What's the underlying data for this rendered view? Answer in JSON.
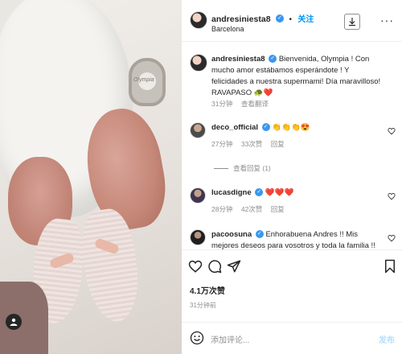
{
  "photo": {
    "pacifier_text": "Olympia"
  },
  "header": {
    "username": "andresiniesta8",
    "verified_mark": "✓",
    "separator": "•",
    "follow_label": "关注",
    "location": "Barcelona",
    "more_label": "···"
  },
  "caption": {
    "username": "andresiniesta8",
    "text": "Bienvenida, Olympia ! Con mucho amor estábamos esperándote ! Y felicidades a nuestra supermami! Día maravilloso! RAVAPASO 🐢❤️",
    "time": "31分钟",
    "translate": "查看翻译"
  },
  "comments": [
    {
      "username": "deco_official",
      "text": "👏👏👏😍",
      "time": "27分钟",
      "likes": "33次赞",
      "reply": "回复"
    },
    {
      "username": "lucasdigne",
      "text": "❤️❤️❤️",
      "time": "28分钟",
      "likes": "42次赞",
      "reply": "回复"
    },
    {
      "username": "pacoosuna",
      "text": "Enhorabuena Andres !! Mis mejores deseos para vosotros y toda la familia !! 🙏❤️🙏",
      "time": "",
      "likes": "",
      "reply": ""
    }
  ],
  "view_replies": "查看回复 (1)",
  "likes_count": "4.1万次赞",
  "post_time": "31分钟前",
  "add_comment_placeholder": "添加评论...",
  "post_button": "发布",
  "colors": {
    "accent": "#0095f6",
    "like_red": "#ed4956",
    "muted": "#8e8e8e"
  }
}
